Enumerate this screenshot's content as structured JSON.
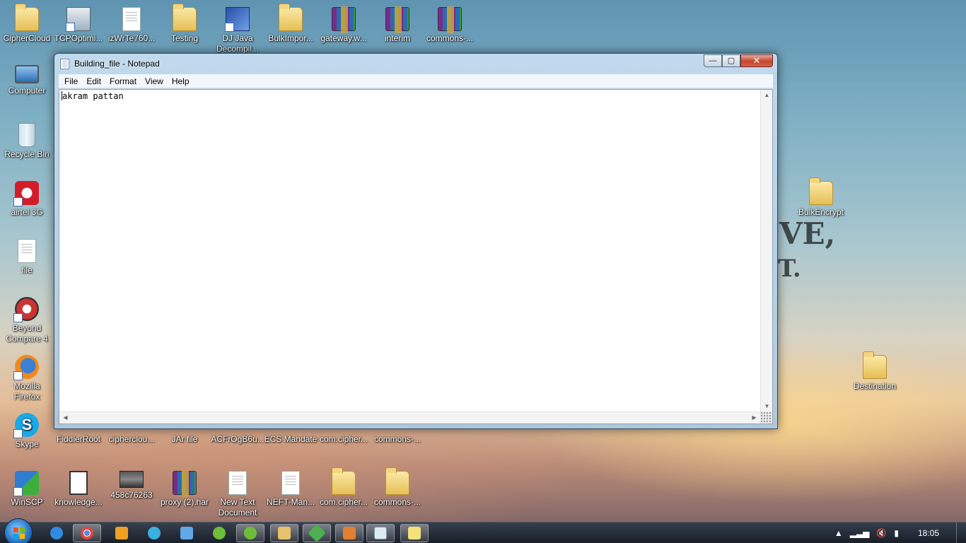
{
  "desktop": {
    "top_row": [
      {
        "label": "CipherCloud",
        "icon": "folder-icon"
      },
      {
        "label": "TCPOptimi...",
        "icon": "tcp-optimizer-icon"
      },
      {
        "label": "izWrTe760...",
        "icon": "document-icon"
      },
      {
        "label": "Testing",
        "icon": "folder-icon"
      },
      {
        "label": "DJ Java Decompil...",
        "icon": "dj-java-icon"
      },
      {
        "label": "BulkImpor...",
        "icon": "folder-icon"
      },
      {
        "label": "gateway.w...",
        "icon": "winrar-archive-icon"
      },
      {
        "label": "interim",
        "icon": "winrar-archive-icon"
      },
      {
        "label": "commons-...",
        "icon": "winrar-archive-icon"
      }
    ],
    "left_column": [
      {
        "label": "Computer",
        "icon": "computer-icon"
      },
      {
        "label": "Recycle Bin",
        "icon": "recycle-bin-icon"
      },
      {
        "label": "airtel 3G",
        "icon": "airtel-icon"
      },
      {
        "label": "file",
        "icon": "file-icon"
      },
      {
        "label": "Beyond Compare 4",
        "icon": "beyond-compare-icon"
      },
      {
        "label": "Mozilla Firefox",
        "icon": "firefox-icon"
      },
      {
        "label": "Skype",
        "icon": "skype-icon"
      },
      {
        "label": "WinSCP",
        "icon": "winscp-icon"
      }
    ],
    "middle_row": [
      {
        "label": "FiddlerRoot"
      },
      {
        "label": "cipherclou..."
      },
      {
        "label": "JAr file"
      },
      {
        "label": "ACFrOgB6u..."
      },
      {
        "label": "ECS Mandate"
      },
      {
        "label": "com.cipher..."
      },
      {
        "label": "commons-..."
      }
    ],
    "bottom_row": [
      {
        "label": "knowledge...",
        "icon": "white-file-icon"
      },
      {
        "label": "458c76263",
        "icon": "photo-icon"
      },
      {
        "label": "proxy (2).har",
        "icon": "winrar-archive-icon"
      },
      {
        "label": "New Text Document",
        "icon": "text-document-icon"
      },
      {
        "label": "NEFT-Man...",
        "icon": "document-icon"
      },
      {
        "label": "com.cipher...",
        "icon": "folder-icon"
      },
      {
        "label": "commons-...",
        "icon": "folder-icon"
      }
    ],
    "right_icons": [
      {
        "label": "BulkEncrypt",
        "icon": "folder-icon"
      },
      {
        "label": "Destination",
        "icon": "folder-icon"
      }
    ],
    "wallpaper_text": [
      "VE,",
      "T."
    ]
  },
  "notepad": {
    "title": "Building_file - Notepad",
    "menu": [
      "File",
      "Edit",
      "Format",
      "View",
      "Help"
    ],
    "content": "akram pattan",
    "controls": {
      "minimize": "—",
      "maximize": "▢",
      "close": "✕"
    }
  },
  "taskbar": {
    "clock": "18:05",
    "items": [
      {
        "name": "internet-explorer",
        "color": "#2f8be0"
      },
      {
        "name": "chrome",
        "color": "#e04a3a"
      },
      {
        "name": "media-player",
        "color": "#f0a020"
      },
      {
        "name": "chrome-alt",
        "color": "#3cb0e0"
      },
      {
        "name": "vpn-client",
        "color": "#60a8e8"
      },
      {
        "name": "spring-tool",
        "color": "#6dbf3b"
      },
      {
        "name": "spring-tool-2",
        "color": "#6dbf3b"
      },
      {
        "name": "file-explorer",
        "color": "#e6c36a"
      },
      {
        "name": "fiddler",
        "color": "#4cb050"
      },
      {
        "name": "winscp",
        "color": "#e08030"
      },
      {
        "name": "notepad",
        "color": "#dfe9f2"
      },
      {
        "name": "sticky-notes",
        "color": "#f2e27a"
      }
    ]
  },
  "colors": {
    "accent": "#2a76c7",
    "close_button": "#c8452d"
  }
}
